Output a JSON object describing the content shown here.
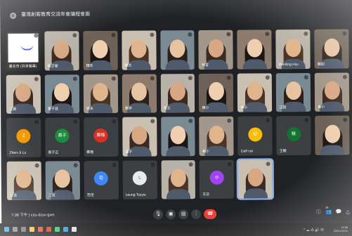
{
  "meeting": {
    "title": "臺灣創客教育交流年會議程會面"
  },
  "tiles": [
    {
      "name": "臺北市 (共享螢幕)",
      "kind": "slide"
    },
    {
      "name": "黃芷瑩",
      "kind": "video"
    },
    {
      "name": "顏欣",
      "kind": "video"
    },
    {
      "name": "陳芃",
      "kind": "video"
    },
    {
      "name": "",
      "kind": "video"
    },
    {
      "name": "林宜",
      "kind": "video"
    },
    {
      "name": "",
      "kind": "video"
    },
    {
      "name": "Wenling Hsu",
      "kind": "video"
    },
    {
      "name": "魏如",
      "kind": "video"
    },
    {
      "name": "江晨",
      "kind": "video"
    },
    {
      "name": "曹子芸",
      "kind": "video"
    },
    {
      "name": "張永",
      "kind": "video"
    },
    {
      "name": "黃伊",
      "kind": "video"
    },
    {
      "name": "吳立",
      "kind": "video"
    },
    {
      "name": "陳小",
      "kind": "video"
    },
    {
      "name": "李小",
      "kind": "video"
    },
    {
      "name": "江語",
      "kind": "video"
    },
    {
      "name": "黃小",
      "kind": "video"
    },
    {
      "name": "Zhen-Ji Lu",
      "kind": "avatar",
      "initial": "Z",
      "color": "#f29900"
    },
    {
      "name": "高子正",
      "kind": "avatar",
      "initial": "高子",
      "color": "#1e8e3e"
    },
    {
      "name": "鄭楷",
      "kind": "avatar",
      "initial": "鄭楷",
      "color": "#d93025"
    },
    {
      "name": "溫子",
      "kind": "video"
    },
    {
      "name": "",
      "kind": "video"
    },
    {
      "name": "楊小",
      "kind": "video"
    },
    {
      "name": "Ceff cat",
      "kind": "avatar",
      "initial": "🐱",
      "color": "#fbbc04"
    },
    {
      "name": "王駿",
      "kind": "avatar",
      "initial": "駿",
      "color": "#137333"
    },
    {
      "name": "",
      "kind": "video"
    },
    {
      "name": "江佳",
      "kind": "video"
    },
    {
      "name": "二班",
      "kind": "video"
    },
    {
      "name": "范佳",
      "kind": "avatar",
      "initial": "范",
      "color": "#4285f4"
    },
    {
      "name": "Leung Tszyiu",
      "kind": "avatar",
      "initial": "L",
      "color": "#e8eaed"
    },
    {
      "name": "",
      "kind": "video"
    },
    {
      "name": "王正",
      "kind": "avatar",
      "initial": "◎",
      "color": "#a142f4"
    },
    {
      "name": "",
      "kind": "video",
      "active": true
    }
  ],
  "bottom": {
    "time": "7:38 下午",
    "separator": "|",
    "code": "czu-dzsv-gwn",
    "people": "34"
  },
  "controls": {
    "mic": "mic-icon",
    "cam": "camera-icon",
    "present": "present-icon",
    "more": "more-vert-icon",
    "hangup": "call-end-icon"
  },
  "right_controls": [
    "info-icon",
    "people-icon",
    "chat-icon",
    "activities-icon"
  ],
  "taskbar": {
    "time": "11:56",
    "date": "2021/12/21",
    "tray": "^ ☁ ⁂ 🔊 中"
  }
}
